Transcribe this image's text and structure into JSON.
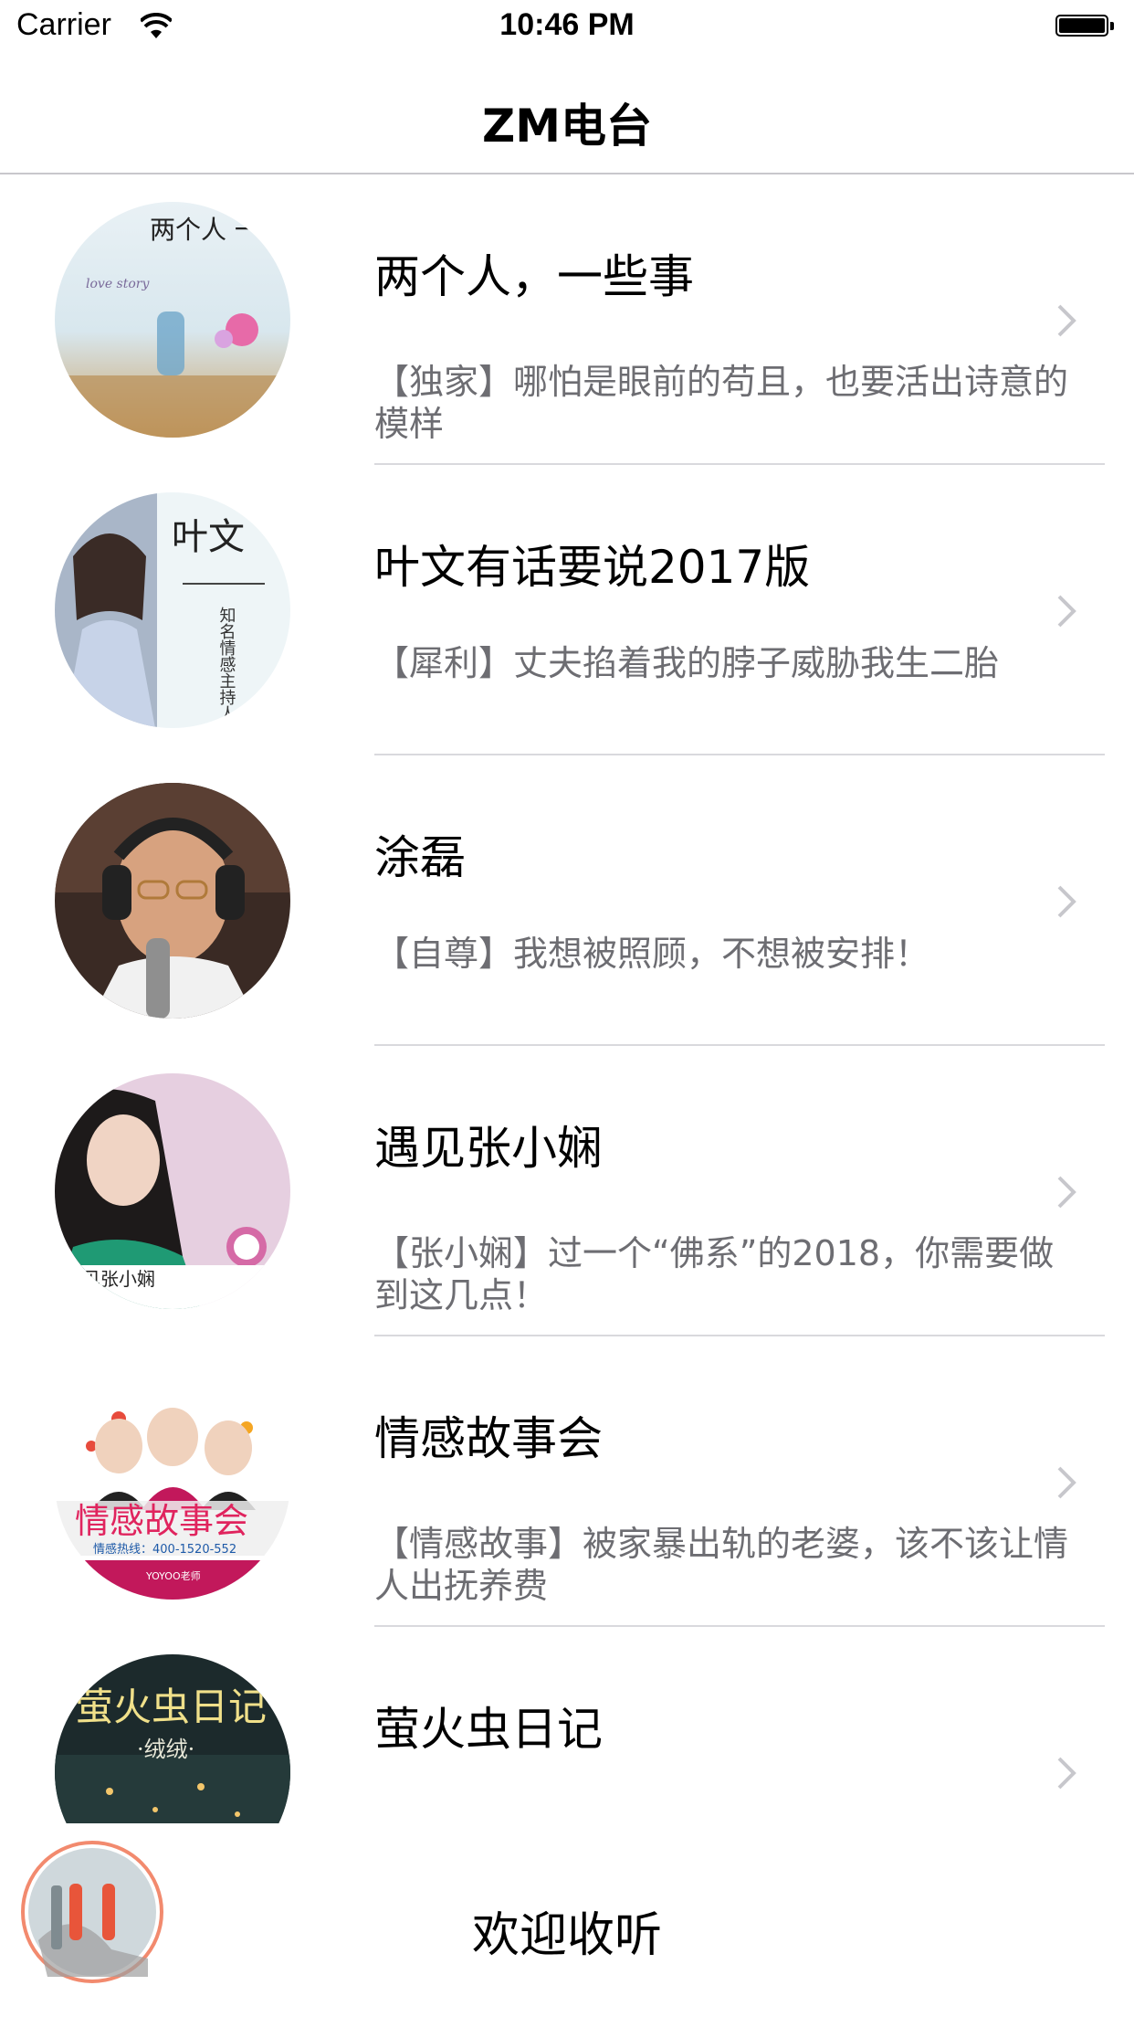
{
  "status_bar": {
    "carrier": "Carrier",
    "time": "10:46 PM",
    "battery_level": 1.0
  },
  "nav": {
    "title": "ZM电台"
  },
  "rows": [
    {
      "title": "两个人，一些事",
      "subtitle": "【独家】哪怕是眼前的苟且，也要活出诗意的模样",
      "art": "两个人 一些事",
      "art_sub": "love story",
      "icon": "album-cover"
    },
    {
      "title": "叶文有话要说2017版",
      "subtitle": "【犀利】丈夫掐着我的脖子威胁我生二胎",
      "art": "叶文",
      "art_sub": "知名情感主持人",
      "icon": "album-cover"
    },
    {
      "title": "涂磊",
      "subtitle": "【自尊】我想被照顾，不想被安排！",
      "icon": "album-cover"
    },
    {
      "title": "遇见张小娴",
      "subtitle": "【张小娴】过一个“佛系”的2018，你需要做到这几点！",
      "art": "见张小娴",
      "icon": "album-cover"
    },
    {
      "title": "情感故事会",
      "subtitle": "【情感故事】被家暴出轨的老婆，该不该让情人出抚养费",
      "art": "情感故事会",
      "art_sub": "情感热线：400-1520-552",
      "art_sub2": "YOYOO老师",
      "icon": "album-cover"
    },
    {
      "title": "萤火虫日记",
      "subtitle": "",
      "art": "萤火虫日记",
      "art_sub": "·绒绒·",
      "icon": "album-cover"
    }
  ],
  "player": {
    "label": "欢迎收听",
    "button_icon": "pause-icon"
  },
  "colors": {
    "separator": "#d9d9dd",
    "subtitle": "#6d6d72",
    "player_ring": "#f28a6e",
    "pause": "#e8553a"
  }
}
